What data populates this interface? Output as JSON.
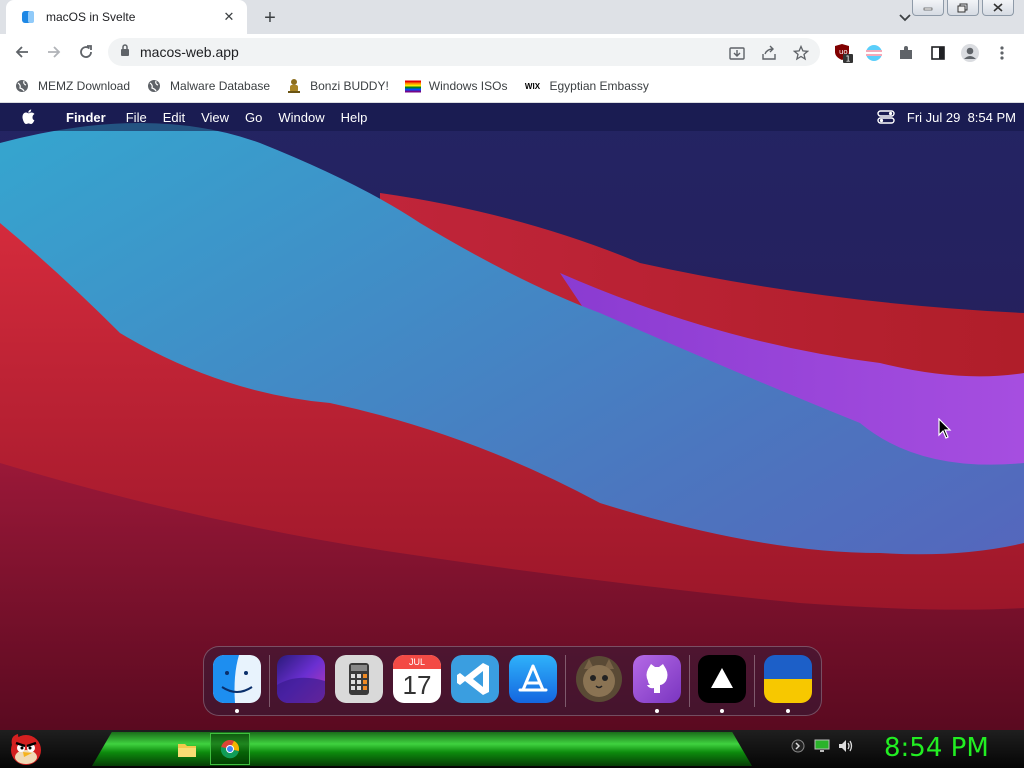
{
  "browser": {
    "tab_title": "macOS in Svelte",
    "tab_close_glyph": "✕",
    "new_tab_glyph": "+",
    "url": "macos-web.app",
    "extension_badge": "1",
    "bookmarks": [
      {
        "label": "MEMZ Download",
        "icon": "globe-icon"
      },
      {
        "label": "Malware Database",
        "icon": "globe-icon"
      },
      {
        "label": "Bonzi BUDDY!",
        "icon": "bonzi-icon"
      },
      {
        "label": "Windows ISOs",
        "icon": "rainbow-flag-icon"
      },
      {
        "label": "Egyptian Embassy",
        "icon": "wix-icon"
      }
    ],
    "wix_text": "WIX"
  },
  "macos": {
    "menus": [
      "Finder",
      "File",
      "Edit",
      "View",
      "Go",
      "Window",
      "Help"
    ],
    "clock": "Fri Jul 29  8:54 PM",
    "calendar_month": "JUL",
    "calendar_day": "17",
    "dock_apps": [
      {
        "name": "Finder",
        "running": true
      },
      {
        "name": "Wallpapers",
        "running": false
      },
      {
        "name": "Calculator",
        "running": false
      },
      {
        "name": "Calendar",
        "running": false
      },
      {
        "name": "VS Code",
        "running": false
      },
      {
        "name": "App Store",
        "running": false
      },
      {
        "name": "Purrfect",
        "running": false
      },
      {
        "name": "GitHub",
        "running": true
      },
      {
        "name": "Vercel",
        "running": true
      },
      {
        "name": "Ukraine",
        "running": true
      }
    ]
  },
  "taskbar": {
    "clock": "8:54 PM"
  },
  "colors": {
    "taskbar_clock": "#22ee22",
    "menubar_text": "#ffffff"
  }
}
